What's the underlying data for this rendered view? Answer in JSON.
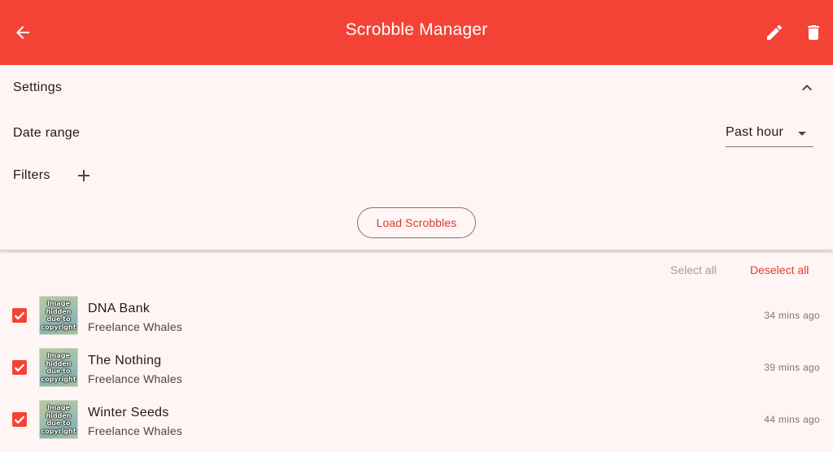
{
  "app": {
    "title": "Scrobble Manager",
    "accent_color": "#f44336",
    "back_icon": "arrow-back-icon",
    "edit_icon": "pencil-icon",
    "delete_icon": "trash-icon"
  },
  "settings": {
    "header": "Settings",
    "collapse_icon": "chevron-up-icon",
    "date_range_label": "Date range",
    "date_range_value": "Past hour",
    "filters_label": "Filters",
    "add_filter_icon": "plus-icon",
    "load_button": "Load Scrobbles"
  },
  "selection": {
    "select_all": "Select all",
    "deselect_all": "Deselect all"
  },
  "scrobbles": [
    {
      "track": "DNA Bank",
      "artist": "Freelance Whales",
      "time": "34 mins ago",
      "checked": true,
      "thumb_text": "Image hidden due to copyright"
    },
    {
      "track": "The Nothing",
      "artist": "Freelance Whales",
      "time": "39 mins ago",
      "checked": true,
      "thumb_text": "Image hidden due to copyright"
    },
    {
      "track": "Winter Seeds",
      "artist": "Freelance Whales",
      "time": "44 mins ago",
      "checked": true,
      "thumb_text": "Image hidden due to copyright"
    }
  ]
}
